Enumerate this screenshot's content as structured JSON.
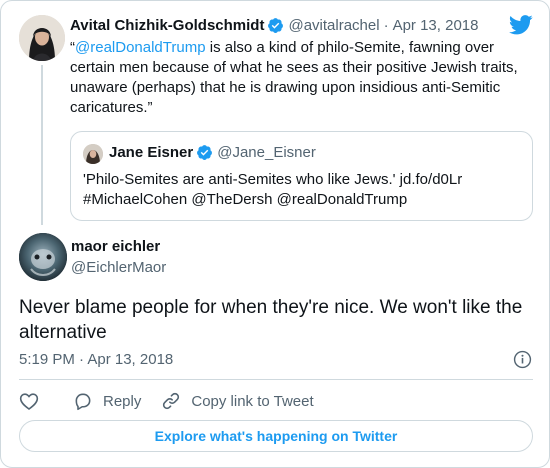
{
  "parent_tweet": {
    "author_name": "Avital Chizhik-Goldschmidt",
    "handle": "@avitalrachel",
    "separator": "·",
    "date": "Apr 13, 2018",
    "text_open_quote": "“",
    "mention": "@realDonaldTrump",
    "text_body": " is also a kind of philo-Semite, fawning over certain men because of what he sees as their positive Jewish traits, unaware (perhaps) that he is drawing upon insidious anti-Semitic caricatures.”",
    "quoted_tweet": {
      "author_name": "Jane Eisner",
      "handle": "@Jane_Eisner",
      "line1": "'Philo-Semites are anti-Semites who like Jews.'  jd.fo/d0Lr",
      "line2": "#MichaelCohen  @TheDersh @realDonaldTrump"
    }
  },
  "main_tweet": {
    "author_name": "maor eichler",
    "handle": "@EichlerMaor",
    "text": "Never blame people for when they're nice. We won't like the alternative",
    "timestamp": "5:19 PM · Apr 13, 2018"
  },
  "actions": {
    "like_icon": "heart-icon",
    "reply_label": "Reply",
    "copy_label": "Copy link to Tweet"
  },
  "explore_label": "Explore what's happening on Twitter",
  "colors": {
    "accent": "#1d9bf0",
    "text": "#0f1419",
    "muted": "#536471",
    "border": "#cfd9de"
  }
}
